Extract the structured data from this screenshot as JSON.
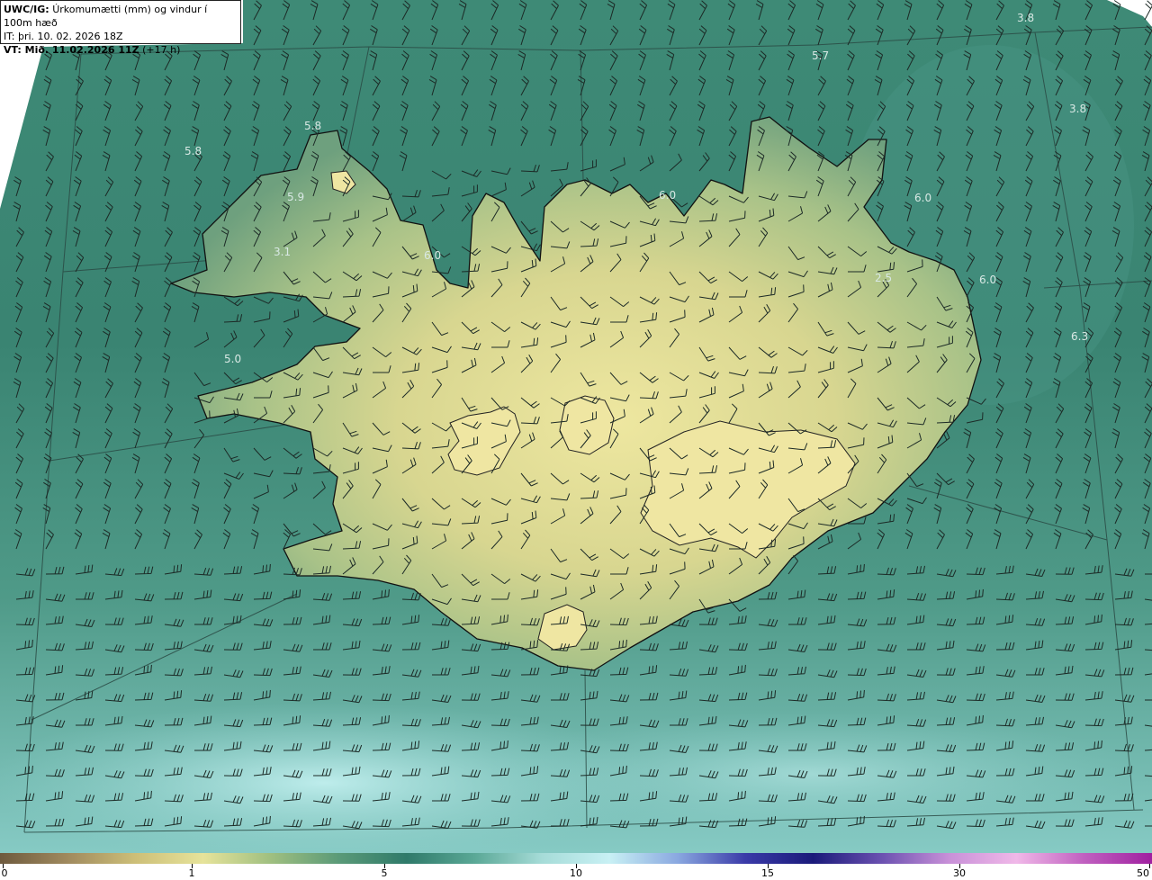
{
  "title": {
    "model": "UWC/IG:",
    "description": "Úrkomumætti (mm) og vindur í 100m hæð",
    "it_line": "IT: þri. 10. 02. 2026 18Z",
    "vt_prefix": "VT: Mið. 11.02.2026 11Z",
    "vt_suffix": "(+17 h)"
  },
  "map_values": [
    {
      "text": "3.8"
    },
    {
      "text": "5.7"
    },
    {
      "text": "3.8"
    },
    {
      "text": "5.8"
    },
    {
      "text": "5.8"
    },
    {
      "text": "5.9"
    },
    {
      "text": "6.0"
    },
    {
      "text": "6.0"
    },
    {
      "text": "3.1"
    },
    {
      "text": "6.0"
    },
    {
      "text": "2.5"
    },
    {
      "text": "6.0"
    },
    {
      "text": "6.3"
    },
    {
      "text": "5.0"
    }
  ],
  "colorbar": {
    "ticks": [
      "0",
      "1",
      "5",
      "10",
      "15",
      "30",
      "50"
    ],
    "colors": [
      "#6e5a3e",
      "#a08a5e",
      "#cdbf78",
      "#e6e39a",
      "#9fbf80",
      "#5a9a78",
      "#2f7a6a",
      "#5aa896",
      "#a6dcd8",
      "#c8f0f4",
      "#8aa8e0",
      "#3a3aa8",
      "#1a1a7a",
      "#6a50b0",
      "#c890d8",
      "#f0b8e8",
      "#c060c0",
      "#a020a0"
    ]
  }
}
